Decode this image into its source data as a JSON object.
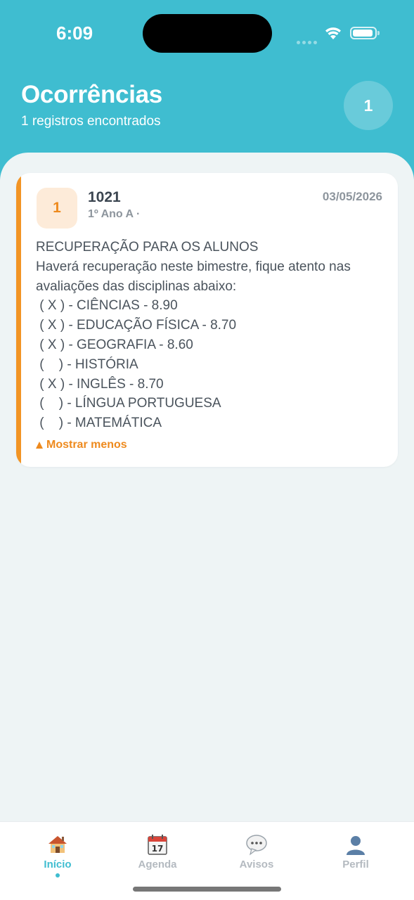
{
  "status_bar": {
    "time": "6:09"
  },
  "header": {
    "title": "Ocorrências",
    "subtitle": "1 registros encontrados",
    "count": "1"
  },
  "card": {
    "badge": "1",
    "code": "1021",
    "class": "1º Ano A ·",
    "date": "03/05/2026",
    "accent_color": "#f29424",
    "lines": [
      "RECUPERAÇÃO PARA OS ALUNOS",
      "Haverá recuperação neste bimestre, fique atento nas",
      "avaliações das disciplinas abaixo:",
      " ( X ) - CIÊNCIAS - 8.90",
      " ( X ) - EDUCAÇÃO FÍSICA - 8.70",
      " ( X ) - GEOGRAFIA - 8.60",
      " (    ) - HISTÓRIA",
      " ( X ) - INGLÊS - 8.70",
      " (    ) - LÍNGUA PORTUGUESA",
      " (    ) - MATEMÁTICA"
    ],
    "toggle_label": "Mostrar menos"
  },
  "tabbar": {
    "tabs": [
      {
        "label": "Início",
        "icon": "house-icon",
        "active": true
      },
      {
        "label": "Agenda",
        "icon": "calendar-icon",
        "active": false
      },
      {
        "label": "Avisos",
        "icon": "speech-bubble-icon",
        "active": false
      },
      {
        "label": "Perfil",
        "icon": "person-icon",
        "active": false
      }
    ]
  },
  "colors": {
    "primary": "#3fbdd0",
    "accent": "#f29424"
  }
}
